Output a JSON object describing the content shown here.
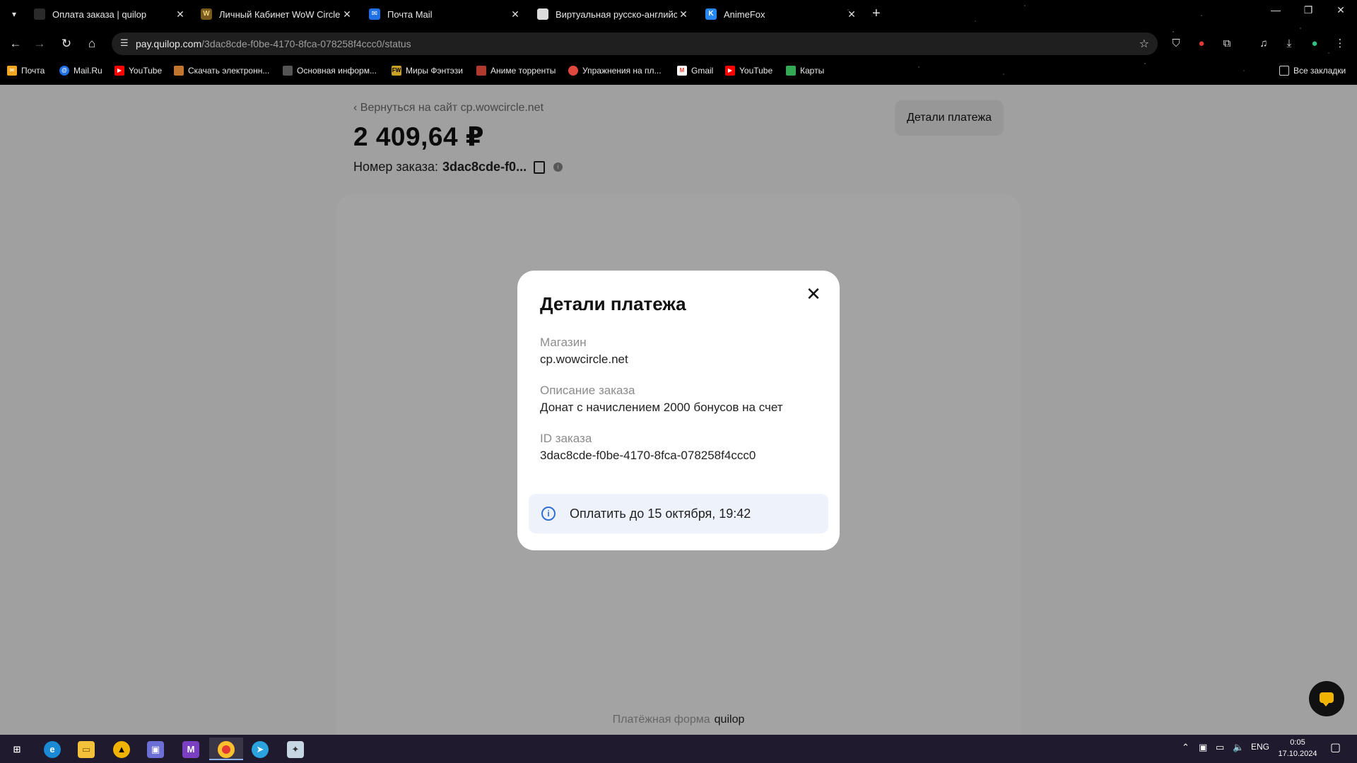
{
  "browser": {
    "tabs": [
      {
        "title": "Оплата заказа | quilop",
        "icon": "quilop-favicon",
        "color": "#2a2a2a"
      },
      {
        "title": "Личный Кабинет WoW Circle",
        "icon": "wowcircle-favicon",
        "color": "#7a5a1e"
      },
      {
        "title": "Почта Mail",
        "icon": "mail-favicon",
        "color": "#1f6fe5"
      },
      {
        "title": "Виртуальная русско-английск",
        "icon": "keyboard-favicon",
        "color": "#dcdcdc"
      },
      {
        "title": "AnimeFox",
        "icon": "vk-favicon",
        "color": "#2787f5"
      }
    ],
    "url_host": "pay.quilop.com",
    "url_path": "/3dac8cde-f0be-4170-8fca-078258f4ccc0/status",
    "bookmarks": [
      {
        "label": "Почта",
        "color": "#f5a623"
      },
      {
        "label": "Mail.Ru",
        "color": "#1f6fe5"
      },
      {
        "label": "YouTube",
        "color": "#ff0000"
      },
      {
        "label": "Скачать электронн...",
        "color": "#c0762e"
      },
      {
        "label": "Основная информ...",
        "color": "#888888"
      },
      {
        "label": "Миры Фэнтэзи",
        "color": "#c9a227"
      },
      {
        "label": "Аниме торренты",
        "color": "#b03a2e"
      },
      {
        "label": "Упражнения на пл...",
        "color": "#e0483e"
      },
      {
        "label": "Gmail",
        "color": "#ea4335"
      },
      {
        "label": "YouTube",
        "color": "#ff0000"
      },
      {
        "label": "Карты",
        "color": "#34a853"
      }
    ],
    "all_bookmarks_label": "Все закладки"
  },
  "page": {
    "back_link": "Вернуться на сайт cp.wowcircle.net",
    "amount": "2 409,64 ₽",
    "order_label": "Номер заказа:",
    "order_short": "3dac8cde-f0...",
    "details_button": "Детали платежа",
    "footer_text": "Платёжная форма",
    "footer_brand": "quilop"
  },
  "modal": {
    "title": "Детали платежа",
    "close": "✕",
    "fields": [
      {
        "label": "Магазин",
        "value": "cp.wowcircle.net"
      },
      {
        "label": "Описание заказа",
        "value": "Донат с начислением 2000 бонусов на счет"
      },
      {
        "label": "ID заказа",
        "value": "3dac8cde-f0be-4170-8fca-078258f4ccc0"
      }
    ],
    "due_text": "Оплатить до 15 октября, 19:42",
    "accent": "#2f6fd6"
  },
  "taskbar": {
    "lang": "ENG",
    "time": "0:05",
    "date": "17.10.2024"
  }
}
